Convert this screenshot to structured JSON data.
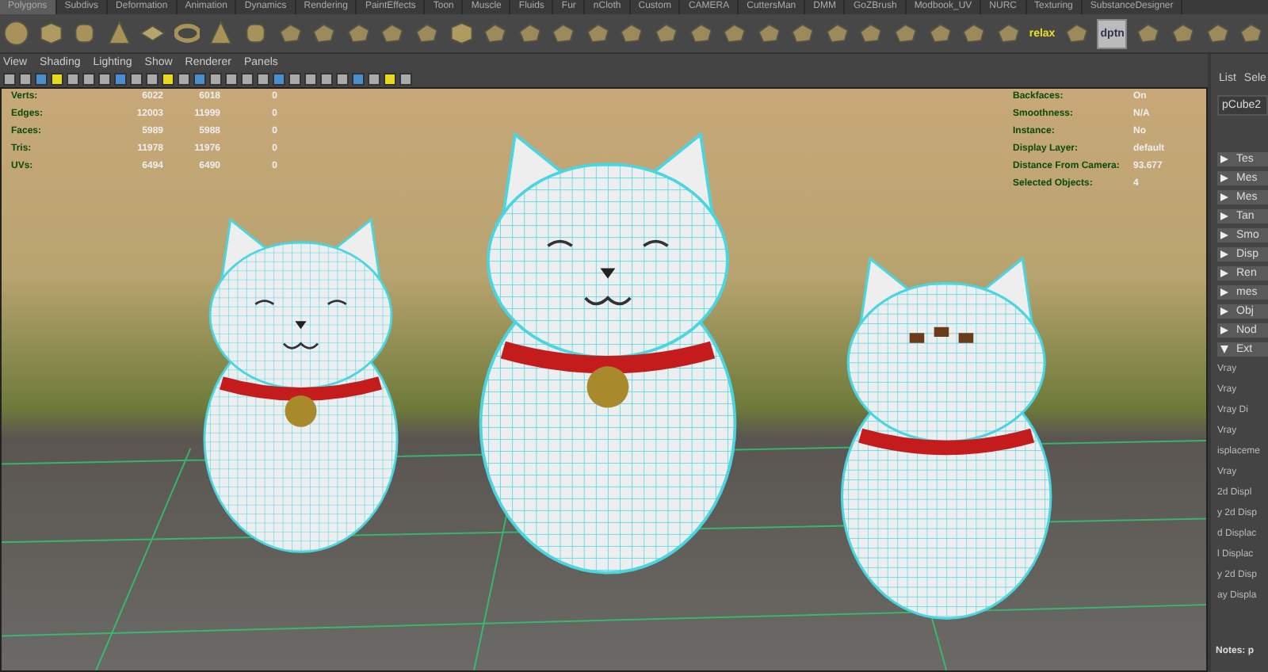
{
  "shelf": {
    "tabs": [
      {
        "label": "Polygons",
        "selected": true
      },
      {
        "label": "Subdivs",
        "selected": false
      },
      {
        "label": "Deformation",
        "selected": false
      },
      {
        "label": "Animation",
        "selected": false
      },
      {
        "label": "Dynamics",
        "selected": false
      },
      {
        "label": "Rendering",
        "selected": false
      },
      {
        "label": "PaintEffects",
        "selected": false
      },
      {
        "label": "Toon",
        "selected": false
      },
      {
        "label": "Muscle",
        "selected": false
      },
      {
        "label": "Fluids",
        "selected": false
      },
      {
        "label": "Fur",
        "selected": false
      },
      {
        "label": "nCloth",
        "selected": false
      },
      {
        "label": "Custom",
        "selected": false
      },
      {
        "label": "CAMERA",
        "selected": false
      },
      {
        "label": "CuttersMan",
        "selected": false
      },
      {
        "label": "DMM",
        "selected": false
      },
      {
        "label": "GoZBrush",
        "selected": false
      },
      {
        "label": "Modbook_UV",
        "selected": false
      },
      {
        "label": "NURC",
        "selected": false
      },
      {
        "label": "Texturing",
        "selected": false
      },
      {
        "label": "SubstanceDesigner",
        "selected": false
      }
    ],
    "tool_labels": [
      {
        "label": "relax"
      },
      {
        "label": "dptn"
      }
    ]
  },
  "viewport_menu": [
    "View",
    "Shading",
    "Lighting",
    "Show",
    "Renderer",
    "Panels"
  ],
  "hud_left": [
    {
      "label": "Verts:",
      "values": [
        "6022",
        "6018",
        "0"
      ]
    },
    {
      "label": "Edges:",
      "values": [
        "12003",
        "11999",
        "0"
      ]
    },
    {
      "label": "Faces:",
      "values": [
        "5989",
        "5988",
        "0"
      ]
    },
    {
      "label": "Tris:",
      "values": [
        "11978",
        "11976",
        "0"
      ]
    },
    {
      "label": "UVs:",
      "values": [
        "6494",
        "6490",
        "0"
      ]
    }
  ],
  "hud_right": [
    {
      "label": "Backfaces:",
      "value": "On"
    },
    {
      "label": "Smoothness:",
      "value": "N/A"
    },
    {
      "label": "Instance:",
      "value": "No"
    },
    {
      "label": "Display Layer:",
      "value": "default"
    },
    {
      "label": "Distance From Camera:",
      "value": "93.677"
    },
    {
      "label": "Selected Objects:",
      "value": "4"
    }
  ],
  "attribute_editor": {
    "tabs": [
      "List",
      "Sele"
    ],
    "node": "pCube2",
    "sections": [
      {
        "label": "Tes",
        "expanded": false
      },
      {
        "label": "Mes",
        "expanded": false
      },
      {
        "label": "Mes",
        "expanded": false
      },
      {
        "label": "Tan",
        "expanded": false
      },
      {
        "label": "Smo",
        "expanded": false
      },
      {
        "label": "Disp",
        "expanded": false
      },
      {
        "label": "Ren",
        "expanded": false
      },
      {
        "label": "mes",
        "expanded": false
      },
      {
        "label": "Obj",
        "expanded": false
      },
      {
        "label": "Nod",
        "expanded": false
      },
      {
        "label": "Ext",
        "expanded": true
      }
    ],
    "attributes": [
      "Vray",
      "Vray",
      "Vray Di",
      "Vray",
      "isplaceme",
      "Vray",
      "2d Displ",
      "y 2d Disp",
      "d Displac",
      "l Displac",
      "y 2d Disp",
      "ay Displa"
    ],
    "notes": "Notes: p"
  }
}
